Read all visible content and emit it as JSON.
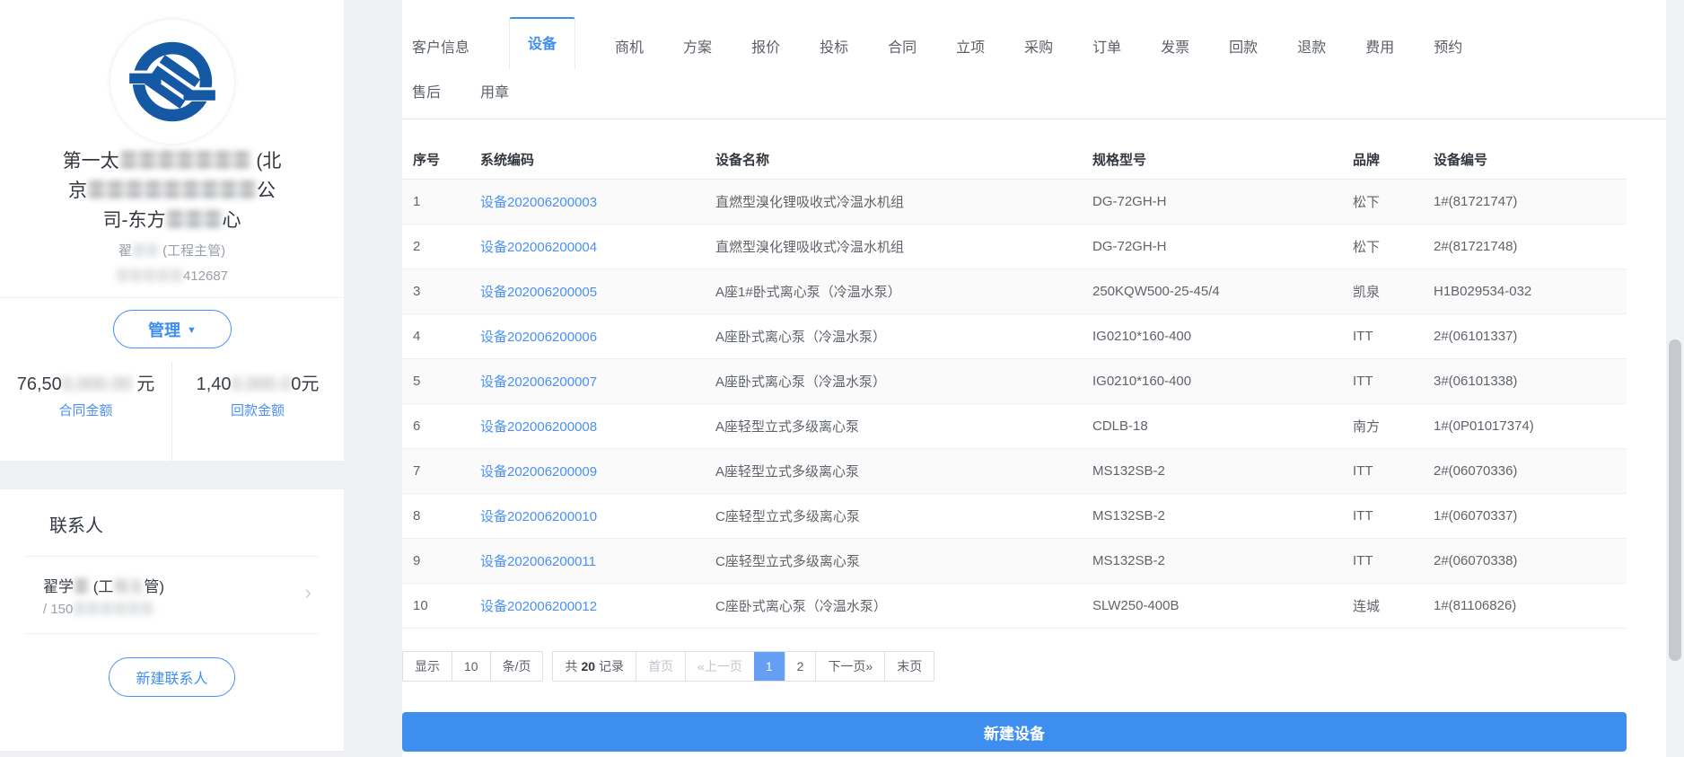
{
  "colors": {
    "accent_blue": "#3e8ef0",
    "link_blue": "#4a90f2",
    "logo_blue": "#1558a3",
    "active_page_bg": "#649ff3",
    "row_stripe": "#fafafa",
    "page_background": "#eef0f4"
  },
  "sidebar": {
    "company_name_lines": [
      {
        "parts": [
          {
            "text": "第一太",
            "redacted": false
          },
          {
            "text": "〓〓〓〓〓〓〓",
            "redacted": true
          },
          {
            "text": " (北",
            "redacted": false
          }
        ]
      },
      {
        "parts": [
          {
            "text": "京",
            "redacted": false
          },
          {
            "text": "〓〓〓〓〓〓〓〓〓",
            "redacted": true
          },
          {
            "text": "公",
            "redacted": false
          }
        ]
      },
      {
        "parts": [
          {
            "text": "司-东方",
            "redacted": false
          },
          {
            "text": "〓〓〓",
            "redacted": true
          },
          {
            "text": "心",
            "redacted": false
          }
        ]
      }
    ],
    "owner_name": {
      "parts": [
        {
          "text": "翟",
          "redacted": false
        },
        {
          "text": "〓〓",
          "redacted": true
        },
        {
          "text": " (工程主管)",
          "redacted": false
        }
      ]
    },
    "owner_phone": {
      "parts": [
        {
          "text": "〓〓〓〓〓",
          "redacted": true
        },
        {
          "text": "412687",
          "redacted": false
        }
      ]
    },
    "manage_label": "管理",
    "caret_icon": "▼",
    "stats": {
      "contract": {
        "value_parts": [
          {
            "text": "76,50",
            "redacted": false
          },
          {
            "text": "0,000.00",
            "redacted": true
          },
          {
            "text": " 元",
            "redacted": false
          }
        ],
        "label": "合同金额"
      },
      "payment": {
        "value_parts": [
          {
            "text": "1,40",
            "redacted": false
          },
          {
            "text": "0,000.0",
            "redacted": true
          },
          {
            "text": "0元",
            "redacted": false
          }
        ],
        "label": "回款金额"
      }
    },
    "contacts": {
      "title": "联系人",
      "item": {
        "name_parts": [
          {
            "text": "翟学",
            "redacted": false
          },
          {
            "text": "〓",
            "redacted": true
          },
          {
            "text": " (工",
            "redacted": false
          },
          {
            "text": "程主",
            "redacted": true
          },
          {
            "text": "管)",
            "redacted": false
          }
        ],
        "phone_parts": [
          {
            "text": "/ 150",
            "redacted": false
          },
          {
            "text": "〓〓〓〓〓〓",
            "redacted": true
          }
        ],
        "chevron_icon": "›"
      },
      "new_contact_label": "新建联系人"
    }
  },
  "tabs": {
    "active": "设备",
    "row1": [
      {
        "label": "客户信息",
        "slug": "customer-info"
      },
      {
        "label": "设备",
        "slug": "equipment"
      },
      {
        "label": "商机",
        "slug": "opportunity"
      },
      {
        "label": "方案",
        "slug": "solution"
      },
      {
        "label": "报价",
        "slug": "quotation"
      },
      {
        "label": "投标",
        "slug": "bidding"
      },
      {
        "label": "合同",
        "slug": "contract"
      },
      {
        "label": "立项",
        "slug": "project-setup"
      },
      {
        "label": "采购",
        "slug": "procurement"
      },
      {
        "label": "订单",
        "slug": "order"
      },
      {
        "label": "发票",
        "slug": "invoice"
      },
      {
        "label": "回款",
        "slug": "payment-received"
      },
      {
        "label": "退款",
        "slug": "refund"
      },
      {
        "label": "费用",
        "slug": "expense"
      },
      {
        "label": "预约",
        "slug": "appointment"
      }
    ],
    "row2": [
      {
        "label": "售后",
        "slug": "after-sales"
      },
      {
        "label": "用章",
        "slug": "seal-use"
      }
    ]
  },
  "table": {
    "headers": [
      {
        "label": "序号",
        "slug": "seq"
      },
      {
        "label": "系统编码",
        "slug": "system-code"
      },
      {
        "label": "设备名称",
        "slug": "device-name"
      },
      {
        "label": "规格型号",
        "slug": "spec-model"
      },
      {
        "label": "品牌",
        "slug": "brand"
      },
      {
        "label": "设备编号",
        "slug": "device-no"
      }
    ],
    "rows": [
      {
        "seq": "1",
        "code": "设备202006200003",
        "name": "直燃型溴化锂吸收式冷温水机组",
        "spec": "DG-72GH-H",
        "brand": "松下",
        "no": "1#(81721747)"
      },
      {
        "seq": "2",
        "code": "设备202006200004",
        "name": "直燃型溴化锂吸收式冷温水机组",
        "spec": "DG-72GH-H",
        "brand": "松下",
        "no": "2#(81721748)"
      },
      {
        "seq": "3",
        "code": "设备202006200005",
        "name": "A座1#卧式离心泵（冷温水泵）",
        "spec": "250KQW500-25-45/4",
        "brand": "凯泉",
        "no": "H1B029534-032"
      },
      {
        "seq": "4",
        "code": "设备202006200006",
        "name": "A座卧式离心泵（冷温水泵）",
        "spec": "IG0210*160-400",
        "brand": "ITT",
        "no": "2#(06101337)"
      },
      {
        "seq": "5",
        "code": "设备202006200007",
        "name": "A座卧式离心泵（冷温水泵）",
        "spec": "IG0210*160-400",
        "brand": "ITT",
        "no": "3#(06101338)"
      },
      {
        "seq": "6",
        "code": "设备202006200008",
        "name": "A座轻型立式多级离心泵",
        "spec": "CDLB-18",
        "brand": "南方",
        "no": "1#(0P01017374)"
      },
      {
        "seq": "7",
        "code": "设备202006200009",
        "name": "A座轻型立式多级离心泵",
        "spec": "MS132SB-2",
        "brand": "ITT",
        "no": "2#(06070336)"
      },
      {
        "seq": "8",
        "code": "设备202006200010",
        "name": "C座轻型立式多级离心泵",
        "spec": "MS132SB-2",
        "brand": "ITT",
        "no": "1#(06070337)"
      },
      {
        "seq": "9",
        "code": "设备202006200011",
        "name": "C座轻型立式多级离心泵",
        "spec": "MS132SB-2",
        "brand": "ITT",
        "no": "2#(06070338)"
      },
      {
        "seq": "10",
        "code": "设备202006200012",
        "name": "C座卧式离心泵（冷温水泵）",
        "spec": "SLW250-400B",
        "brand": "连城",
        "no": "1#(81106826)"
      }
    ]
  },
  "pagination": {
    "display_label": "显示",
    "page_size": "10",
    "unit_label": "条/页",
    "total_prefix": "共",
    "total_count": "20",
    "total_suffix": "记录",
    "first_label": "首页",
    "prev_label": "«上一页",
    "pages": [
      "1",
      "2"
    ],
    "active_page": "1",
    "next_label": "下一页»",
    "last_label": "末页"
  },
  "actions": {
    "new_device_label": "新建设备"
  }
}
